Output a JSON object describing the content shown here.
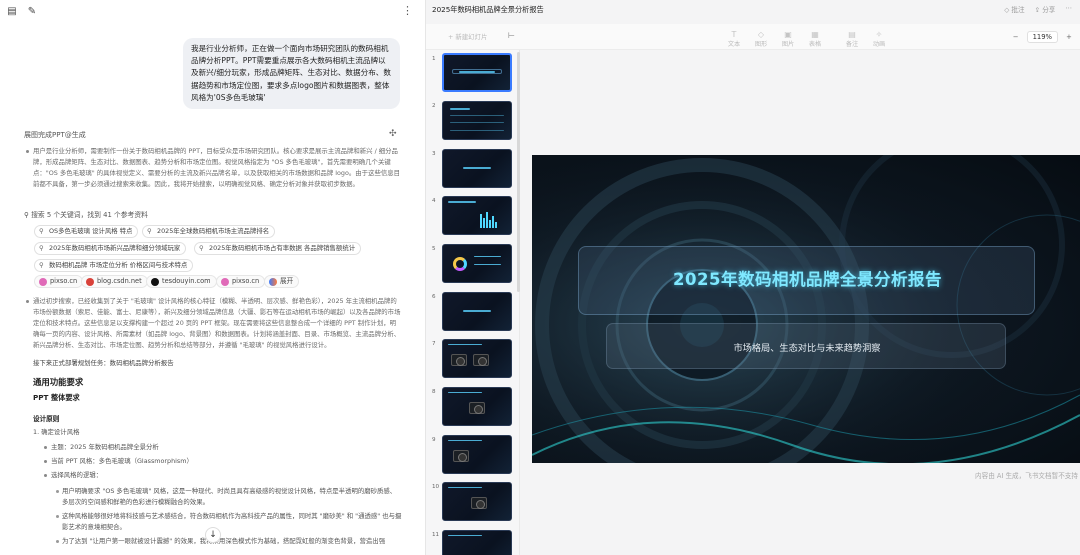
{
  "chat": {
    "user_prompt": "我是行业分析师，正在做一个面向市场研究团队的数码相机品牌分析PPT。PPT需要重点展示各大数码相机主流品牌以及新兴/细分玩家，形成品牌矩阵、生态对比、数据分布、数据趋势和市场定位图，要求多点logo图片和数据图表，整体风格为'0S多色毛玻璃'",
    "ppt_section_label": "展图完成PPT@生成",
    "para1": "用户是行业分析师，需要制作一份关于数码相机品牌的 PPT，目标受众是市场研究团队。核心要求是展示主流品牌和新兴 / 细分品牌，形成品牌矩阵、生态对比、数据图表、趋势分析和市场定位图。视觉风格指定为 \"OS 多色毛玻璃\"，首先需要明确几个关键点：\"OS 多色毛玻璃\" 的具体视觉定义、需要分析的主流及新兴品牌名单，以及获取相关的市场数据和品牌 logo。由于这些信息目前都不具备，第一步必须通过搜索来收集。因此，我将开始搜索，以明确视觉风格、确定分析对象并获取初步数据。",
    "search_summary": "搜索 5 个关键词，找到 41 个参考资料",
    "chips": [
      "OS多色毛玻璃 设计风格 特点",
      "2025年全球数码相机市场主流品牌排名",
      "2025年数码相机市场新兴品牌和细分领域玩家",
      "2025年数码相机市场占有率数据 各品牌销售额统计",
      "数码相机品牌 市场定位分析 价格区间与技术特点"
    ],
    "sources": [
      "pixso.cn",
      "blog.csdn.net",
      "tesdouyin.com",
      "pixso.cn",
      "展开"
    ],
    "para2": "通过初步搜索，已经收集到了关于 \"毛玻璃\" 设计风格的核心特征（模糊、半透明、层次感、鲜艳色彩），2025 年主流相机品牌的市场份额数据（索尼、佳能、富士、尼康等），新兴及细分领域品牌信息（大疆、影石等在运动相机市场的崛起）以及各品牌的市场定位和技术特点。这些信息足以支撑构建一个超过 20 页的 PPT 框架。现在需要将这些信息整合成一个详细的 PPT 制作计划，明确每一页的内容、设计风格、所需素材（如品牌 logo、背景图）和数据图表。计划将涵盖封面、目录、市场概览、主流品牌分析、新兴品牌分析、生态对比、市场定位图、趋势分析和总结等部分，并遵循 \"毛玻璃\" 的视觉风格进行设计。",
    "next_line": "接下来正式部署规划任务：数码相机品牌分析报告",
    "h_general": "通用功能要求",
    "h_ppt": "PPT 整体要求",
    "h_design": "设计原则",
    "item1": "1. 确定设计风格",
    "item1a": "主题：2025 年数码相机品牌全景分析",
    "item1b": "当前 PPT 风格：多色毛玻璃（Glassmorphism）",
    "item1c": "选择风格的逻辑：",
    "item1c1": "用户明确要求 \"OS 多色毛玻璃\" 风格，这是一种现代、时尚且具有高级感的视觉设计风格，特点是半透明的磨砂质感、多层次的空间感和鲜艳的色彩进行模糊融合的效果。",
    "item1c2": "这种风格能够很好地将科技感与艺术感结合，符合数码相机作为高科技产品的属性，同时其 \"磨砂美\" 和 \"通透感\" 也与摄影艺术的意境相契合。",
    "item1c3": "为了达到 \"让用户第一眼就被设计震撼\" 的效果，我将采用深色模式作为基础，搭配霓虹般的渐变色背景，营造出强"
  },
  "editor": {
    "doc_title": "2025年数码相机品牌全景分析报告",
    "top_right": [
      "◇ 批注",
      "⇪ 分享",
      "⋯"
    ],
    "add_slide": "+ 新建幻灯片",
    "toolbar": [
      "文本",
      "图形",
      "图片",
      "表格",
      "备注",
      "动画"
    ],
    "zoom": "119%",
    "slide_numbers": [
      "1",
      "2",
      "3",
      "4",
      "5",
      "6",
      "7",
      "8",
      "9",
      "10",
      "11"
    ],
    "slide_title": "2025年数码相机品牌全景分析报告",
    "slide_subtitle": "市场格局、生态对比与未来趋势洞察",
    "footer_note": "内容由 AI 生成，飞书文档暂不支持"
  },
  "colors": {
    "accent_title": "#7fe8ff",
    "slide_bg": "#0e1822",
    "selection": "#3a7bff"
  }
}
